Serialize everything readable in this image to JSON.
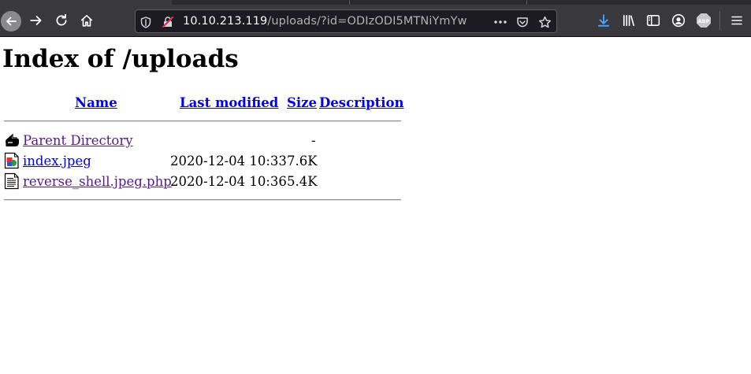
{
  "browser": {
    "url_host": "10.10.213.119",
    "url_path": "/uploads/?id=ODIzODI5MTNiYmYw",
    "icons": [
      "back-icon",
      "forward-icon",
      "reload-icon",
      "home-icon",
      "tracking-shield-icon",
      "insecure-lock-icon",
      "page-actions-icon",
      "pocket-icon",
      "bookmark-star-icon",
      "downloads-icon",
      "library-icon",
      "sidebar-icon",
      "account-icon",
      "adblock-icon",
      "menu-icon"
    ],
    "adblock_label": "ABP",
    "accent_download": "#45a1ff"
  },
  "page": {
    "title": "Index of /uploads",
    "columns": {
      "name": "Name",
      "last_modified": "Last modified",
      "size": "Size",
      "description": "Description"
    },
    "rows": [
      {
        "name": "Parent Directory",
        "modified": "",
        "size": "-",
        "icon": "back-folder-icon",
        "visited": true
      },
      {
        "name": "index.jpeg",
        "modified": "2020-12-04 10:33",
        "size": "7.6K",
        "icon": "image-file-icon",
        "visited": false
      },
      {
        "name": "reverse_shell.jpeg.php",
        "modified": "2020-12-04 10:36",
        "size": "5.4K",
        "icon": "text-file-icon",
        "visited": true
      }
    ]
  }
}
